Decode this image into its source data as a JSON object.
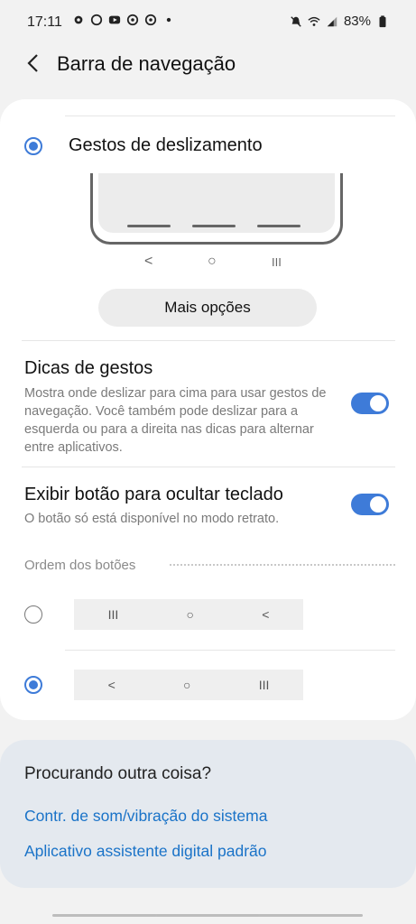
{
  "status_bar": {
    "time": "17:11",
    "battery": "83%",
    "left_icons": [
      "gear-icon",
      "whatsapp-icon",
      "youtube-icon",
      "app-icon",
      "app-icon",
      "dot-icon"
    ],
    "right_icons": [
      "mute-icon",
      "wifi-icon",
      "signal-icon",
      "battery-icon"
    ]
  },
  "header": {
    "title": "Barra de navegação"
  },
  "gesture_option": {
    "label": "Gestos de deslizamento",
    "selected": true,
    "preview_nav": [
      "<",
      "○",
      "III"
    ]
  },
  "more_options_button": "Mais opções",
  "gesture_hints": {
    "title": "Dicas de gestos",
    "description": "Mostra onde deslizar para cima para usar gestos de navegação. Você também pode deslizar para a esquerda ou para a direita nas dicas para alternar entre aplicativos.",
    "enabled": true
  },
  "keyboard_button": {
    "title": "Exibir botão para ocultar teclado",
    "description": "O botão só está disponível no modo retrato.",
    "enabled": true
  },
  "button_order": {
    "header": "Ordem dos botões",
    "options": [
      {
        "selected": false,
        "buttons": [
          "III",
          "○",
          "<"
        ]
      },
      {
        "selected": true,
        "buttons": [
          "<",
          "○",
          "III"
        ]
      }
    ]
  },
  "related": {
    "title": "Procurando outra coisa?",
    "links": [
      "Contr. de som/vibração do sistema",
      "Aplicativo assistente digital padrão"
    ]
  },
  "colors": {
    "accent": "#3e7bd8",
    "link": "#1a73c8"
  }
}
